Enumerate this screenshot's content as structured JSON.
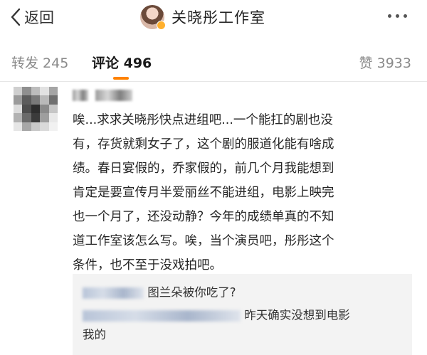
{
  "header": {
    "back_label": "返回",
    "title": "关晓彤工作室",
    "back_icon": "chevron-left-icon",
    "more_icon": "more-dots-icon"
  },
  "tabs": [
    {
      "label": "转发 245"
    },
    {
      "label": "评论 496"
    },
    {
      "label": "赞 3933"
    }
  ],
  "accent_color": "#ff8200",
  "comment": {
    "lines": [
      "唉...求求关晓彤快点进组吧...一个能扛的剧也没",
      "有，存货就剩女子了，这个剧的服道化能有啥成",
      "绩。春日宴假的，乔家假的，前几个月我能想到",
      "肯定是要宣传月半爱丽丝不能进组，电影上映完",
      "也一个月了，还没动静？今年的成绩单真的不知",
      "道工作室该怎么写。唉，当个演员吧，彤彤这个",
      "条件，也不至于没戏拍吧。"
    ]
  },
  "replies": [
    {
      "text": "图兰朵被你吃了?"
    },
    {
      "text": "昨天确实没想到电影",
      "continuation": "我的"
    }
  ]
}
